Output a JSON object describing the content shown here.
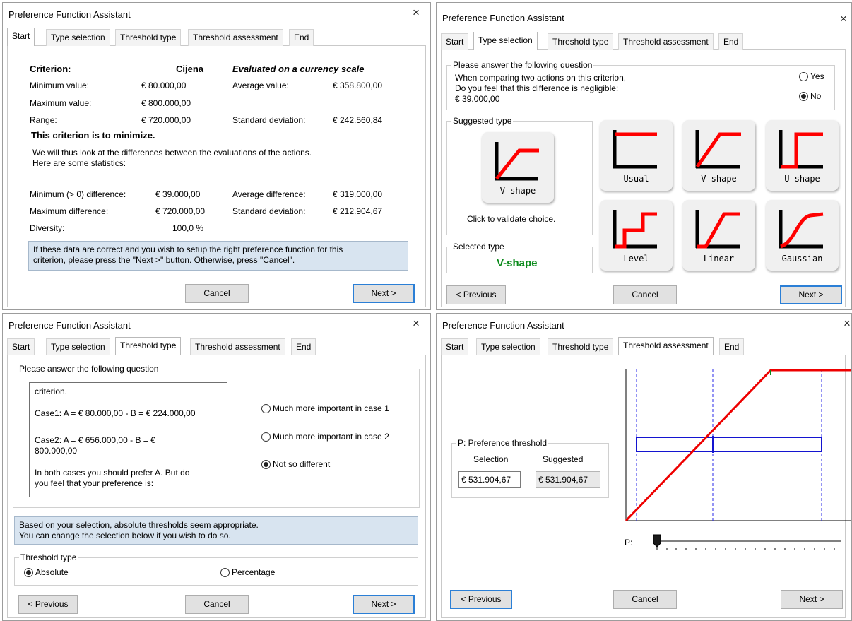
{
  "common": {
    "title": "Preference Function Assistant",
    "close": "×",
    "tabs": [
      "Start",
      "Type selection",
      "Threshold type",
      "Threshold assessment",
      "End"
    ],
    "cancel": "Cancel",
    "next": "Next >",
    "previous": "< Previous"
  },
  "w1": {
    "criterion_label": "Criterion:",
    "criterion_name": "Cijena",
    "scale": "Evaluated on a currency scale",
    "min_label": "Minimum value:",
    "min_value": "€ 80.000,00",
    "max_label": "Maximum value:",
    "max_value": "€ 800.000,00",
    "range_label": "Range:",
    "range_value": "€ 720.000,00",
    "avg_label": "Average value:",
    "avg_value": "€ 358.800,00",
    "std_label": "Standard deviation:",
    "std_value": "€ 242.560,84",
    "minimize": "This criterion is to minimize.",
    "desc1": "We will thus look at the differences between the evaluations of the actions.",
    "desc2": "Here are some statistics:",
    "mindiff_label": "Minimum (> 0) difference:",
    "mindiff_value": "€ 39.000,00",
    "maxdiff_label": "Maximum difference:",
    "maxdiff_value": "€ 720.000,00",
    "diversity_label": "Diversity:",
    "diversity_value": "100,0 %",
    "avgdiff_label": "Average difference:",
    "avgdiff_value": "€ 319.000,00",
    "stddiff_label": "Standard deviation:",
    "stddiff_value": "€ 212.904,67",
    "info1": "If these data are correct and you wish to setup the right preference function for this",
    "info2": "criterion, please press the \"Next >\" button. Otherwise, press \"Cancel\"."
  },
  "w2": {
    "question_title": "Please answer the following question",
    "q1": "When comparing two actions on this criterion,",
    "q2": "Do you feel that this difference is negligible:",
    "q3": "€ 39.000,00",
    "yes": "Yes",
    "no": "No",
    "suggested_title": "Suggested type",
    "suggested_label": "V-shape",
    "click_validate": "Click to validate choice.",
    "selected_title": "Selected type",
    "selected_value": "V-shape",
    "shapes": [
      "Usual",
      "V-shape",
      "U-shape",
      "Level",
      "Linear",
      "Gaussian"
    ]
  },
  "w3": {
    "question_title": "Please answer the following question",
    "case_text0": "criterion.",
    "case1": "Case1: A = € 80.000,00 - B = € 224.000,00",
    "case2a": "Case2: A = € 656.000,00 - B = €",
    "case2b": "800.000,00",
    "prefer1": "In both cases you should prefer A. But do",
    "prefer2": "you feel that your preference is:",
    "opt1": "Much more important in case 1",
    "opt2": "Much more important in case 2",
    "opt3": "Not so different",
    "info1": "Based on your selection, absolute thresholds seem appropriate.",
    "info2": "You can change the selection below if you wish to do so.",
    "threshold_title": "Threshold type",
    "absolute": "Absolute",
    "percentage": "Percentage"
  },
  "w4": {
    "group_title": "P: Preference threshold",
    "selection_label": "Selection",
    "suggested_label": "Suggested",
    "selection_value": "€ 531.904,67",
    "suggested_value": "€ 531.904,67",
    "slider_label": "P:"
  }
}
